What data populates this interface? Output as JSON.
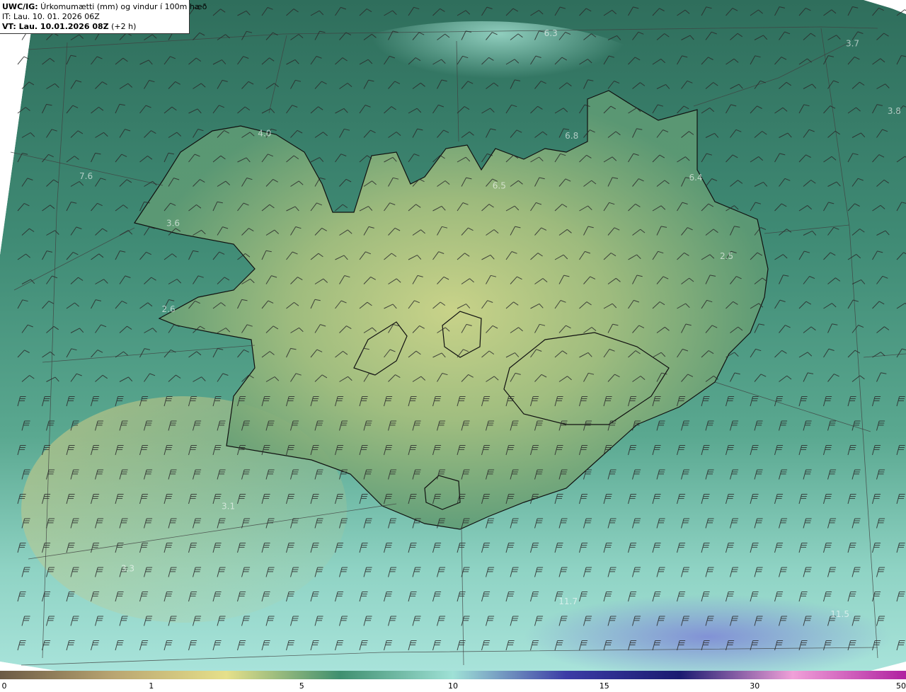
{
  "header": {
    "model": "UWC/IG:",
    "title": " Úrkomumætti (mm) og vindur í 100m hæð",
    "issue_time": "IT: Lau. 10. 01. 2026 06Z",
    "valid_label": "VT: Lau. 10.01.2026 08Z",
    "valid_offset": " (+2 h)"
  },
  "map_labels": [
    {
      "text": "6.3",
      "lon": 0.608,
      "lat": 0.054
    },
    {
      "text": "3.7",
      "lon": 0.941,
      "lat": 0.069
    },
    {
      "text": "3.8",
      "lon": 0.987,
      "lat": 0.17
    },
    {
      "text": "4.0",
      "lon": 0.292,
      "lat": 0.203
    },
    {
      "text": "6.8",
      "lon": 0.631,
      "lat": 0.207
    },
    {
      "text": "7.6",
      "lon": 0.095,
      "lat": 0.267
    },
    {
      "text": "6.5",
      "lon": 0.551,
      "lat": 0.281
    },
    {
      "text": "6.4",
      "lon": 0.768,
      "lat": 0.269
    },
    {
      "text": "3.6",
      "lon": 0.191,
      "lat": 0.337
    },
    {
      "text": "2.5",
      "lon": 0.802,
      "lat": 0.386
    },
    {
      "text": "2.6",
      "lon": 0.186,
      "lat": 0.465
    },
    {
      "text": "3.1",
      "lon": 0.252,
      "lat": 0.759
    },
    {
      "text": "3.3",
      "lon": 0.141,
      "lat": 0.852
    },
    {
      "text": "11.7",
      "lon": 0.627,
      "lat": 0.901
    },
    {
      "text": "11.5",
      "lon": 0.927,
      "lat": 0.92
    }
  ],
  "colorbar": {
    "ticks": [
      {
        "label": "0",
        "value": 0
      },
      {
        "label": "1",
        "value": 1
      },
      {
        "label": "5",
        "value": 5
      },
      {
        "label": "10",
        "value": 10
      },
      {
        "label": "15",
        "value": 15
      },
      {
        "label": "30",
        "value": 30
      },
      {
        "label": "50",
        "value": 50
      }
    ],
    "colors": [
      "#6b5a45",
      "#b9a571",
      "#e6e08a",
      "#3f8f6f",
      "#9fe1d6",
      "#3c3ca6",
      "#1a1a70",
      "#f0a0d8",
      "#b020a0"
    ]
  }
}
